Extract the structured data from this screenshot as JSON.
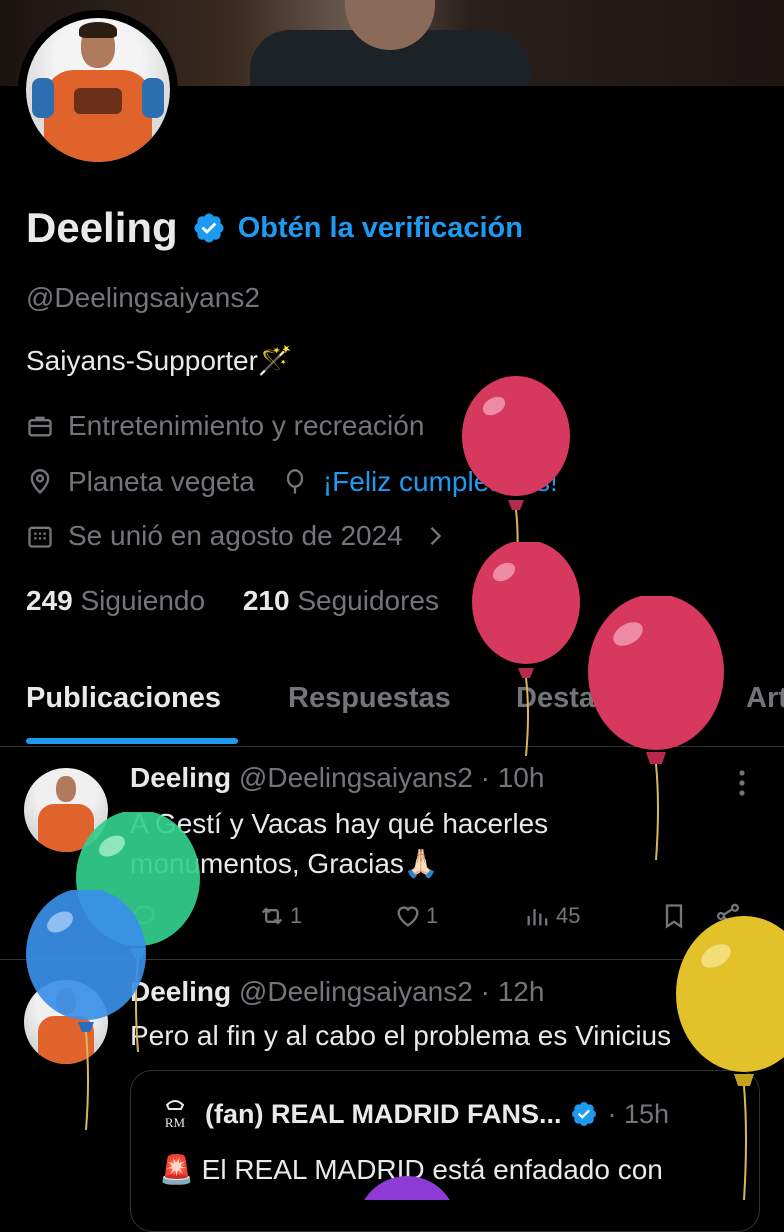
{
  "profile": {
    "display_name": "Deeling",
    "get_verified": "Obtén la verificación",
    "handle": "@Deelingsaiyans2",
    "bio": "Saiyans-Supporter🪄",
    "category": "Entretenimiento y recreación",
    "location": "Planeta vegeta",
    "birthday": "¡Feliz cumpleaños!",
    "joined": "Se unió en agosto de 2024",
    "following_count": "249",
    "following_label": "Siguiendo",
    "followers_count": "210",
    "followers_label": "Seguidores"
  },
  "tabs": [
    "Publicaciones",
    "Respuestas",
    "Destacados",
    "Art"
  ],
  "posts": [
    {
      "name": "Deeling",
      "handle_time": "@Deelingsaiyans2 · 10h",
      "text_line1": "A Gestí y Vacas hay qué hacerles",
      "text_line2": "monumentos, Gracias🙏🏻",
      "retweets": "1",
      "likes": "1",
      "views": "45"
    },
    {
      "name": "Deeling",
      "handle_time": "@Deelingsaiyans2 · 12h",
      "text": "Pero al fin y al cabo el problema es Vinicius",
      "quote": {
        "name": "(fan) REAL MADRID FANS...",
        "time": "· 15h",
        "text": "🚨 El REAL MADRID está enfadado con"
      }
    }
  ],
  "colors": {
    "accent": "#1d9bf0",
    "muted": "#71767b",
    "text": "#e7e9ea",
    "background": "#000000"
  }
}
